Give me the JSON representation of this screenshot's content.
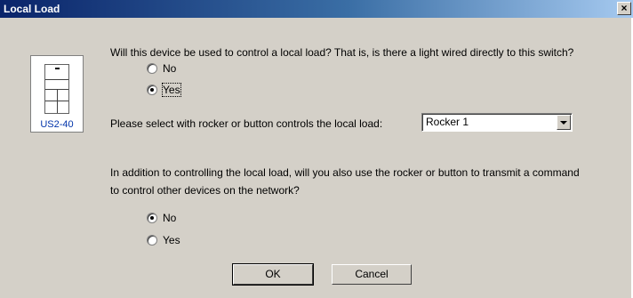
{
  "window": {
    "title": "Local Load",
    "close_glyph": "×"
  },
  "device": {
    "model": "US2-40",
    "icon": "switch-plate-icon"
  },
  "question1": {
    "text": "Will this device be used to control a local load?  That is, is there a light wired directly to this switch?",
    "options": [
      {
        "label": "No",
        "checked": false
      },
      {
        "label": "Yes",
        "checked": true
      }
    ]
  },
  "select_control": {
    "label": "Please select with rocker or button controls the local load:",
    "value": "Rocker 1"
  },
  "question2": {
    "line1": "In addition to controlling the local load, will you also use the rocker or button to transmit a command",
    "line2": "to control other devices on the network?",
    "options": [
      {
        "label": "No",
        "checked": true
      },
      {
        "label": "Yes",
        "checked": false
      }
    ]
  },
  "buttons": {
    "ok": "OK",
    "cancel": "Cancel"
  },
  "colors": {
    "titlebar_start": "#0a246a",
    "titlebar_end": "#a6caf0",
    "dialog_bg": "#d4d0c8",
    "device_caption": "#0033aa"
  }
}
